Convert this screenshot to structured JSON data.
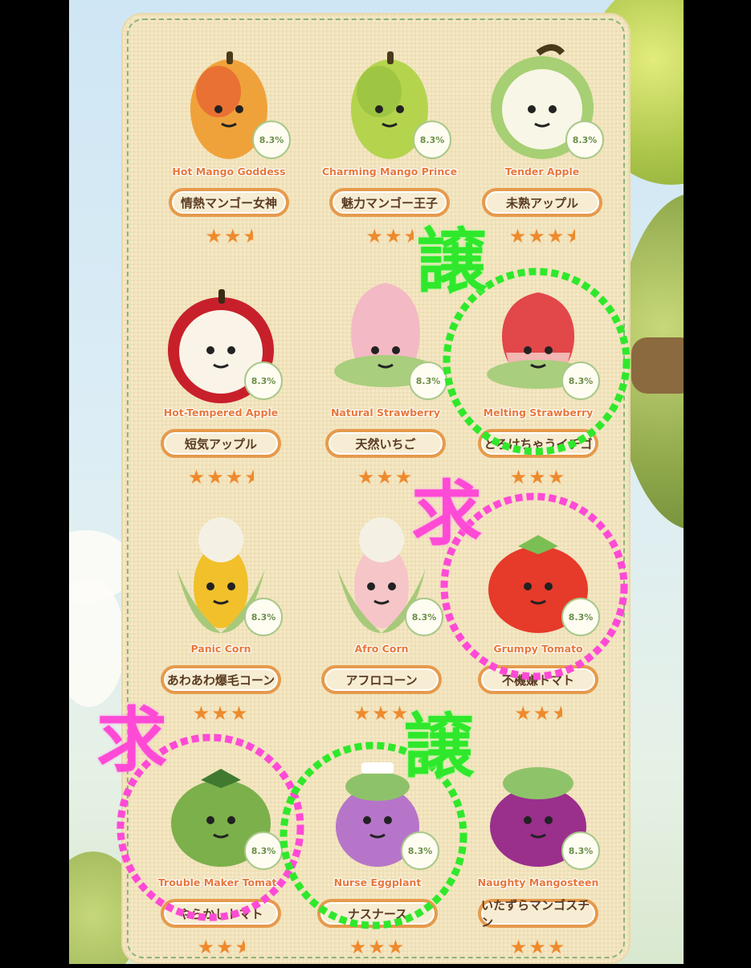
{
  "colors": {
    "accent_orange": "#e8773a",
    "label_border": "#e69a4c",
    "give_mark": "#2fe82b",
    "want_mark": "#ff4ad6",
    "star": "#ee8a2d"
  },
  "items": [
    {
      "name_en": "Hot Mango Goddess",
      "name_jp": "情熱マンゴー女神",
      "prob": "8.3%",
      "stars": 2.5,
      "icon": "mango-plush"
    },
    {
      "name_en": "Charming Mango Prince",
      "name_jp": "魅力マンゴー王子",
      "prob": "8.3%",
      "stars": 2.5,
      "icon": "mango-plush"
    },
    {
      "name_en": "Tender Apple",
      "name_jp": "未熟アップル",
      "prob": "8.3%",
      "stars": 3.5,
      "icon": "green-apple-plush"
    },
    {
      "name_en": "Hot-Tempered Apple",
      "name_jp": "短気アップル",
      "prob": "8.3%",
      "stars": 3.5,
      "icon": "red-apple-plush"
    },
    {
      "name_en": "Natural Strawberry",
      "name_jp": "天然いちご",
      "prob": "8.3%",
      "stars": 3,
      "icon": "pink-strawberry-plush"
    },
    {
      "name_en": "Melting Strawberry",
      "name_jp": "とろけちゃうイチゴ",
      "prob": "8.3%",
      "stars": 3,
      "icon": "red-strawberry-plush"
    },
    {
      "name_en": "Panic Corn",
      "name_jp": "あわあわ爆毛コーン",
      "prob": "8.3%",
      "stars": 3,
      "icon": "yellow-corn-plush"
    },
    {
      "name_en": "Afro Corn",
      "name_jp": "アフロコーン",
      "prob": "8.3%",
      "stars": 3,
      "icon": "pink-corn-plush"
    },
    {
      "name_en": "Grumpy Tomato",
      "name_jp": "不機嫌トマト",
      "prob": "8.3%",
      "stars": 2.5,
      "icon": "red-tomato-plush"
    },
    {
      "name_en": "Trouble Maker Tomato",
      "name_jp": "やらかしトマト",
      "prob": "8.3%",
      "stars": 2.5,
      "icon": "green-tomato-plush"
    },
    {
      "name_en": "Nurse Eggplant",
      "name_jp": "ナスナース",
      "prob": "8.3%",
      "stars": 3,
      "icon": "eggplant-plush"
    },
    {
      "name_en": "Naughty Mangosteen",
      "name_jp": "いたずらマンゴスチン",
      "prob": "8.3%",
      "stars": 3,
      "icon": "mangosteen-plush"
    }
  ],
  "overlays": {
    "give": "譲",
    "want": "求"
  }
}
